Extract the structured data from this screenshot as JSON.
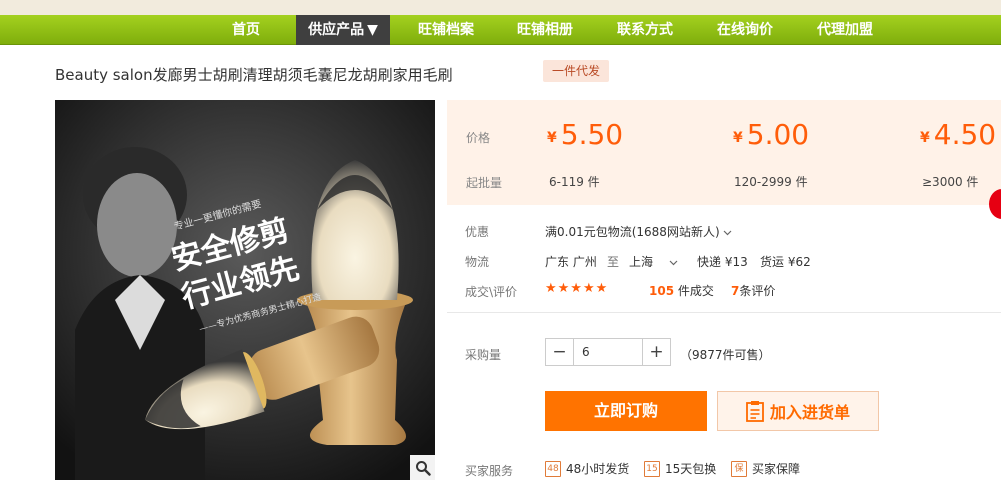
{
  "nav": {
    "items": [
      {
        "label": "首页"
      },
      {
        "label": "供应产品",
        "caret": "▼"
      },
      {
        "label": "旺铺档案"
      },
      {
        "label": "旺铺相册"
      },
      {
        "label": "联系方式"
      },
      {
        "label": "在线询价"
      },
      {
        "label": "代理加盟"
      }
    ],
    "active_index": 1
  },
  "product": {
    "title": "Beauty salon发廊男士胡刷清理胡须毛囊尼龙胡刷家用毛刷",
    "tag": "一件代发",
    "image_text": {
      "line_small": "专业一更懂你的需要",
      "line1": "安全修剪",
      "line2": "行业领先",
      "line_sub": "——专为优秀商务男士精心打造"
    }
  },
  "pricing": {
    "price_label": "价格",
    "qty_label": "起批量",
    "currency": "¥",
    "tiers": [
      {
        "price": "5.50",
        "range": "6-119 件"
      },
      {
        "price": "5.00",
        "range": "120-2999 件"
      },
      {
        "price": "4.50",
        "range": "≥3000 件"
      }
    ]
  },
  "info": {
    "discount_label": "优惠",
    "discount_text": "满0.01元包物流(1688网站新人)",
    "logistics_label": "物流",
    "origin": "广东 广州",
    "to_word": "至",
    "destination": "上海",
    "express": "快递 ¥13",
    "freight": "货运 ¥62",
    "deals_label": "成交\\评价",
    "stars": "★★★★★",
    "deals_count": "105",
    "deals_unit": "件成交",
    "reviews_count": "7",
    "reviews_unit": "条评价"
  },
  "purchase": {
    "qty_label": "采购量",
    "minus": "−",
    "plus": "+",
    "qty_value": "6",
    "stock_text": "（9877件可售）",
    "buy_label": "立即订购",
    "cart_label": "加入进货单"
  },
  "services": {
    "label": "买家服务",
    "items": [
      {
        "badge": "48",
        "text": "48小时发货"
      },
      {
        "badge": "15",
        "text": "15天包换"
      },
      {
        "badge": "保",
        "text": "买家保障"
      }
    ]
  },
  "colors": {
    "nav_green": "#8dbb12",
    "accent_orange": "#ff5d0a",
    "buy_button": "#ff7300",
    "price_bg": "#fff2e8"
  }
}
